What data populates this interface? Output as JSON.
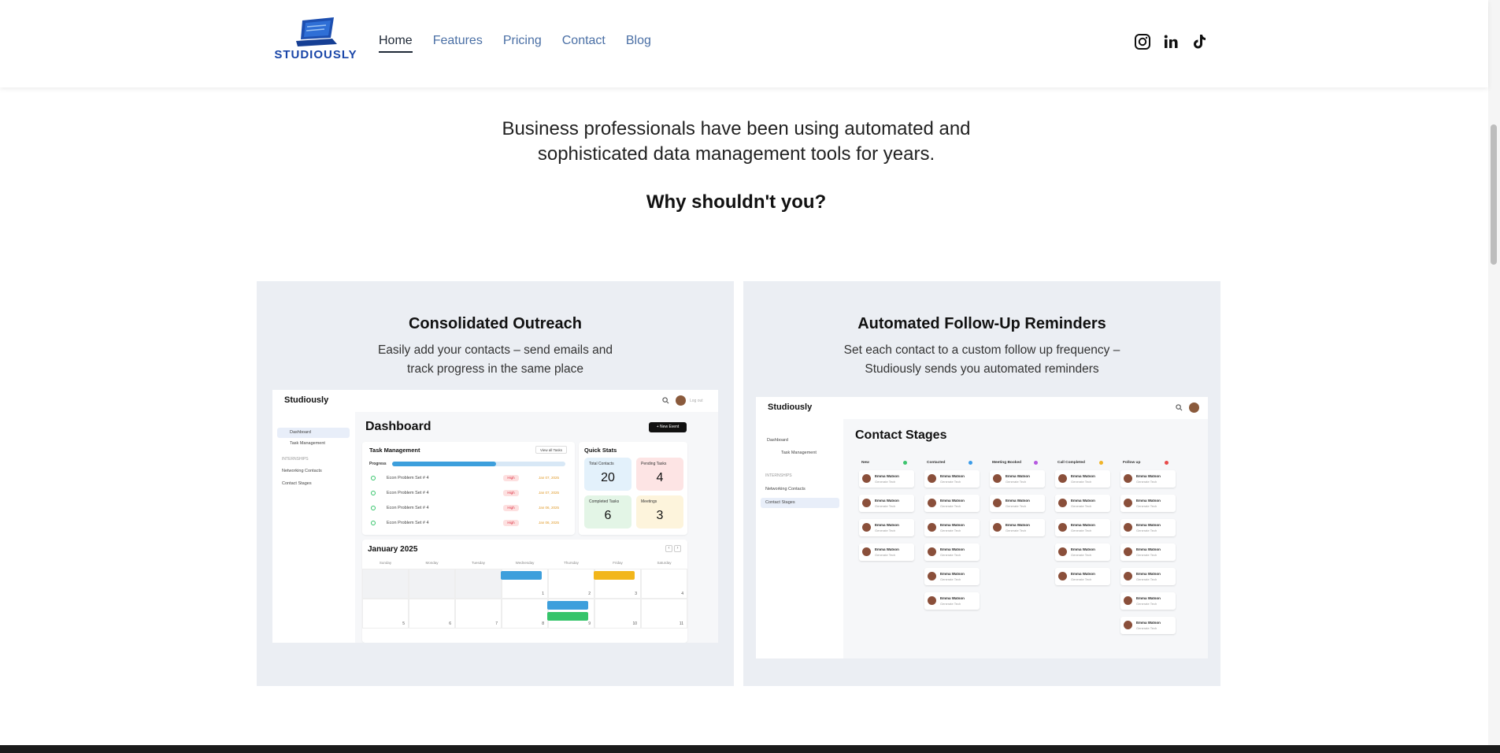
{
  "brand": {
    "name": "STUDIOUSLY"
  },
  "nav": {
    "items": [
      "Home",
      "Features",
      "Pricing",
      "Contact",
      "Blog"
    ]
  },
  "hero": {
    "line1": "Business professionals have been using automated and",
    "line2": "sophisticated data management tools for years.",
    "question": "Why shouldn't you?"
  },
  "cards": {
    "outreach": {
      "title": "Consolidated Outreach",
      "desc1": "Easily add your contacts – send emails and",
      "desc2": "track progress in the same place"
    },
    "reminders": {
      "title": "Automated Follow-Up Reminders",
      "desc1": "Set each contact to a custom follow up frequency –",
      "desc2": "Studiously sends you automated reminders"
    }
  },
  "dashboard": {
    "brand": "Studiously",
    "logout": "Log out",
    "title": "Dashboard",
    "new_event": "+ New Event",
    "sidebar": {
      "dashboard": "Dashboard",
      "task_mgmt": "Task Management",
      "section": "INTERNSHIPS",
      "networking": "Networking Contacts",
      "stages": "Contact Stages"
    },
    "tasks": {
      "title": "Task Management",
      "view_all": "View all Tasks",
      "progress_label": "Progress",
      "progress": 0.6,
      "items": [
        {
          "name": "Econ Problem Set # 4",
          "tag": "High",
          "date": "Jan 07, 2025"
        },
        {
          "name": "Econ Problem Set # 4",
          "tag": "High",
          "date": "Jan 07, 2025"
        },
        {
          "name": "Econ Problem Set # 4",
          "tag": "High",
          "date": "Jan 06, 2025"
        },
        {
          "name": "Econ Problem Set # 4",
          "tag": "High",
          "date": "Jan 06, 2025"
        }
      ]
    },
    "stats": {
      "title": "Quick Stats",
      "items": [
        {
          "label": "Total Contacts",
          "value": "20",
          "color": "#e3f1fb"
        },
        {
          "label": "Pending Tasks",
          "value": "4",
          "color": "#fde4e4"
        },
        {
          "label": "Completed Tasks",
          "value": "6",
          "color": "#e3f5e6"
        },
        {
          "label": "Meetings",
          "value": "3",
          "color": "#fdf4dc"
        }
      ]
    },
    "calendar": {
      "title": "January 2025",
      "days": [
        "Sunday",
        "Monday",
        "Tuesday",
        "Wednesday",
        "Thursday",
        "Friday",
        "Saturday"
      ],
      "row1": [
        "",
        "",
        "",
        "1",
        "2",
        "3",
        "4"
      ],
      "row2": [
        "5",
        "6",
        "7",
        "8",
        "9",
        "10",
        "11"
      ]
    }
  },
  "stages": {
    "brand": "Studiously",
    "title": "Contact Stages",
    "sidebar": {
      "dashboard": "Dashboard",
      "task_mgmt": "Task Management",
      "section": "INTERNSHIPS",
      "networking": "Networking Contacts",
      "stages": "Contact Stages"
    },
    "columns": [
      {
        "name": "New",
        "dot": "#3cc46e",
        "count": 4
      },
      {
        "name": "Contacted",
        "dot": "#3b9be8",
        "count": 6
      },
      {
        "name": "Meeting Booked",
        "dot": "#b558e0",
        "count": 3
      },
      {
        "name": "Call Completed",
        "dot": "#f0b429",
        "count": 5
      },
      {
        "name": "Follow up",
        "dot": "#e84a4a",
        "count": 7
      }
    ],
    "card_name": "Emma Watson",
    "card_sub": "Generate Tech"
  }
}
